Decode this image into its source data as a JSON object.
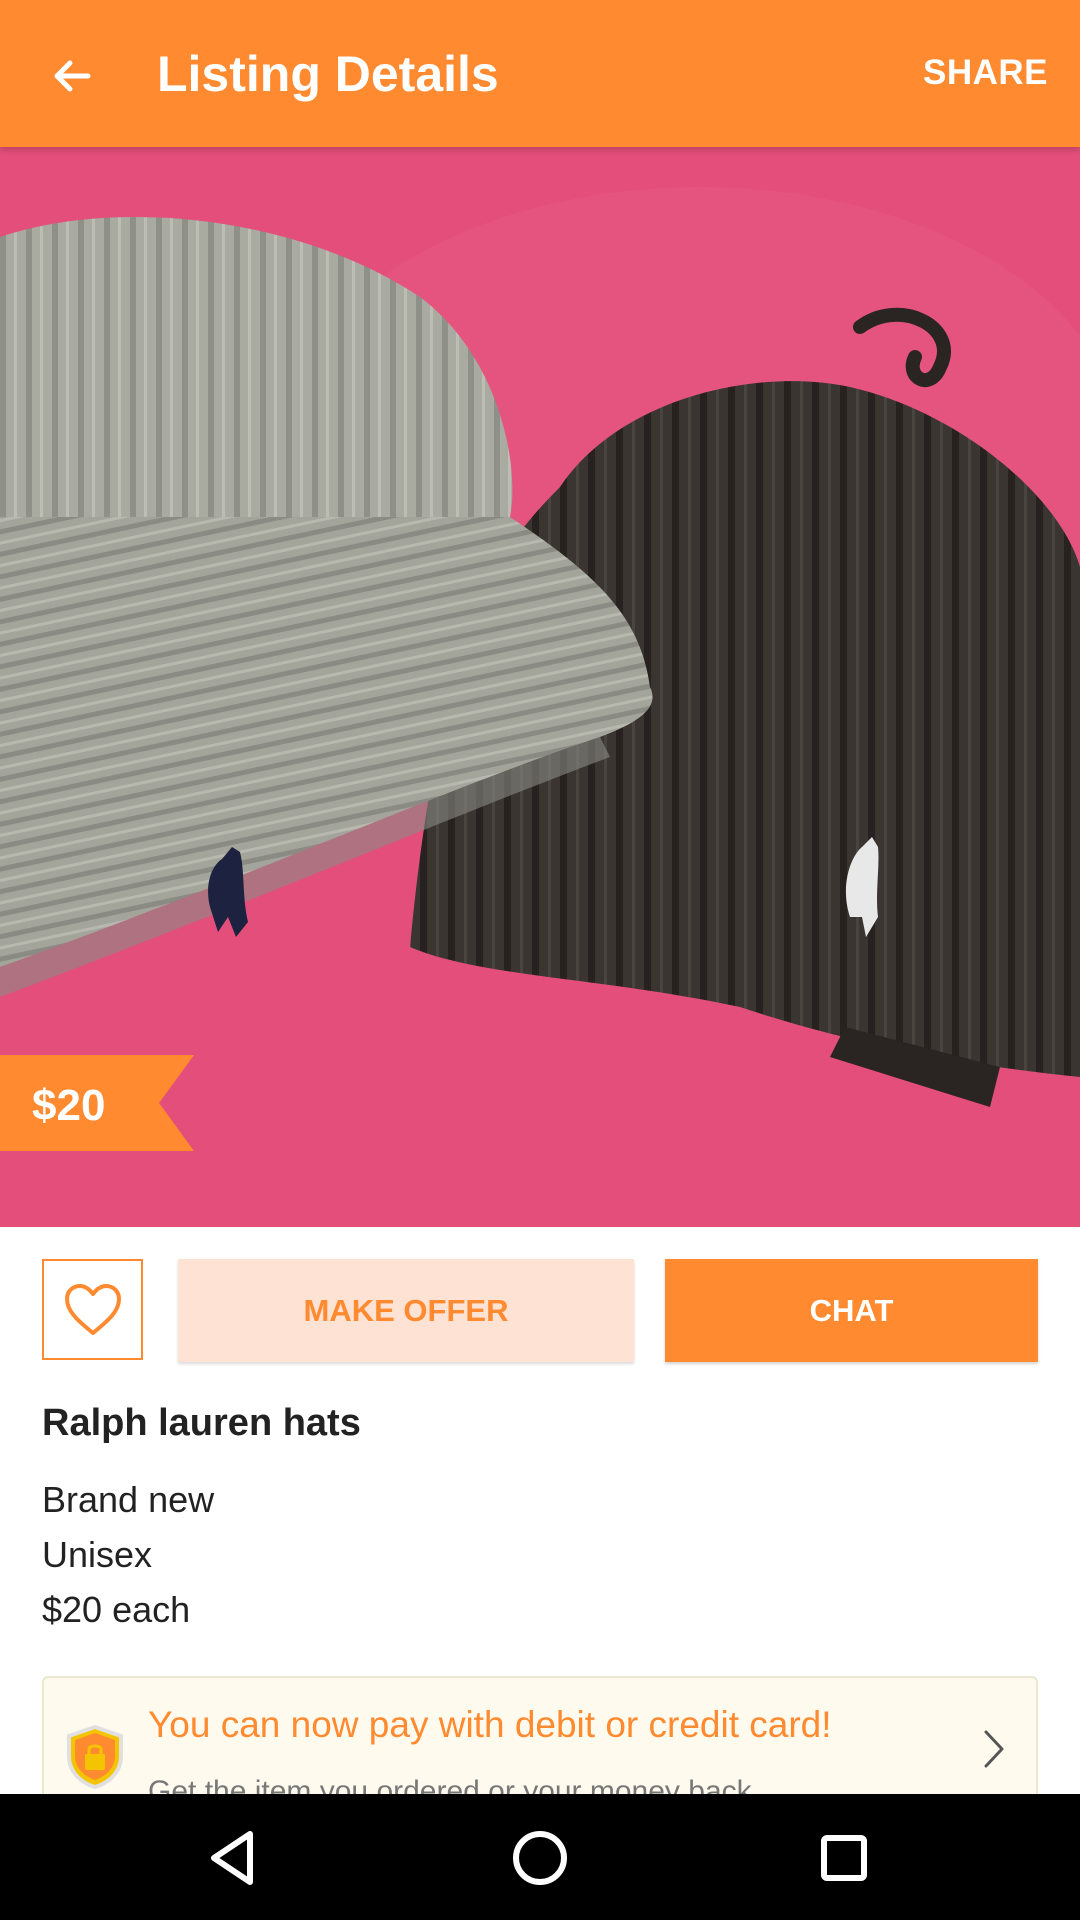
{
  "appbar": {
    "title": "Listing Details",
    "share_label": "SHARE",
    "back_icon": "arrow-left-icon"
  },
  "listing": {
    "price": "$20",
    "title": "Ralph lauren hats",
    "description_lines": [
      "Brand new",
      "Unisex",
      "$20 each"
    ],
    "photo_subject": "two ribbed knit beanies, light grey and dark charcoal, with polo logo on pink background"
  },
  "actions": {
    "favorite_icon": "heart-outline-icon",
    "make_offer_label": "MAKE OFFER",
    "chat_label": "CHAT"
  },
  "payment_banner": {
    "title": "You can now pay with debit or credit card!",
    "subtitle": "Get the item you ordered or your money back",
    "icon": "shield-lock-icon",
    "chevron": "chevron-right-icon"
  },
  "system_nav": {
    "back": "nav-back-icon",
    "home": "nav-home-icon",
    "recents": "nav-recents-icon"
  },
  "colors": {
    "accent": "#ff8a30",
    "offer_bg": "#fee2d4",
    "photo_bg": "#e34f7a",
    "banner_bg": "#fffaee"
  }
}
